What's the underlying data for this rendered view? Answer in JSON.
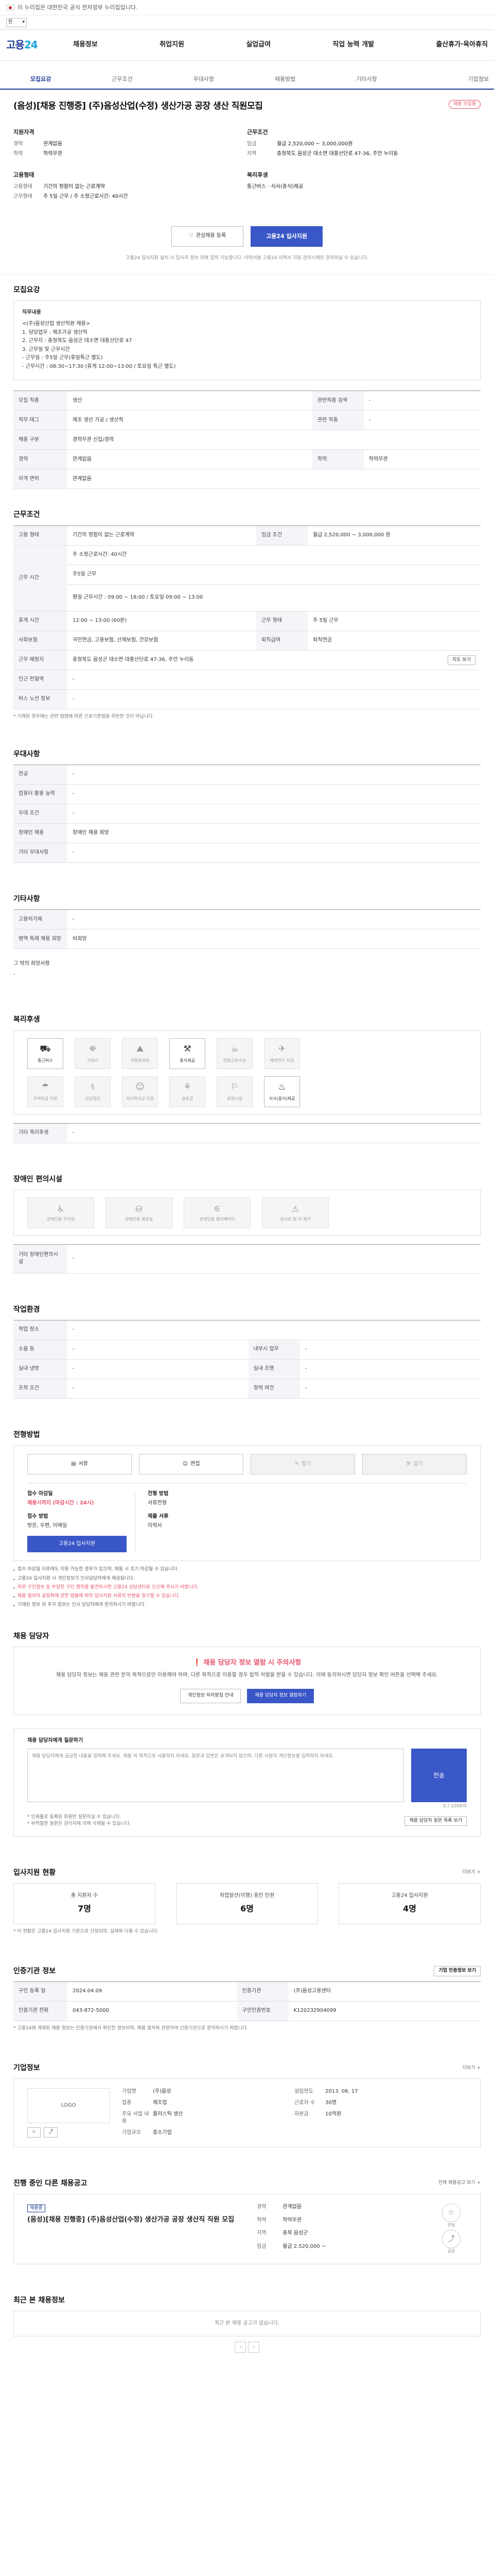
{
  "topbar": {
    "notice": "이 누리집은 대한민국 공식 전자정부 누리집입니다."
  },
  "lang": {
    "selected": "한"
  },
  "logo": {
    "a": "고용",
    "b": "24"
  },
  "gnb": [
    "채용정보",
    "취업지원",
    "실업급여",
    "직업 능력 개발",
    "출산휴가·육아휴직"
  ],
  "tabs": [
    "모집요강",
    "근무조건",
    "우대사항",
    "채용방법",
    "기타사항",
    "기업정보"
  ],
  "hero": {
    "title": "(음성)[채용 진행중] (주)음성산업(수정) 생산가공 공장 생산 직원모집",
    "badge": "채용 모집중",
    "col1_title": "지원자격",
    "col1": [
      {
        "k": "경력",
        "v": "관계없음"
      },
      {
        "k": "학력",
        "v": "학력무관"
      }
    ],
    "col2_title": "근무조건",
    "col2": [
      {
        "k": "임금",
        "v": "월급 2,520,000 ~ 3,000,000원"
      },
      {
        "k": "지역",
        "v": "충청북도 음성군 대소면 대풍산단로 47-36, 주안 누리동"
      }
    ],
    "col3_title": "고용형태",
    "col3": [
      {
        "k": "고용형태",
        "v": "기간의 정함이 없는 근로계약"
      },
      {
        "k": "근무형태",
        "v": "주 5일 근무 / 주 소정근로시간: 40시간"
      }
    ],
    "col4_title": "복리후생",
    "col4": [
      {
        "k": "",
        "v": "통근버스 · 식사(중식)제공"
      }
    ],
    "btn_save": "관심채용 등록",
    "btn_apply": "고용24 입사지원",
    "note": "고용24 입사지원 설치 시 입사지 정보 위해 입력 가능합니다. 이력서를 고용24 이력서 지원 관리시에만 관리하실 수 있습니다."
  },
  "recruit": {
    "title": "모집요강",
    "jobdesc": [
      "직무내용",
      "<(주)음성산업 생산직원 채용>",
      "1. 담당업무 : 제조가공 생산직",
      "2. 근무지 : 충청북도 음성군 대소면 대풍산단로 47",
      "3. 근무일 및 근무시간",
      "- 근무일 : 주5일 근무(휴일특근 별도)",
      "- 근무시간 : 08:30~17:30 (휴게 12:00~13:00 / 토요일 특근 별도)"
    ],
    "rows": [
      [
        {
          "k": "모집 직종",
          "v": "생산"
        },
        {
          "k": "관련직종 검색",
          "v": "-"
        }
      ],
      [
        {
          "k": "직무 태그",
          "v": "제조 생산 가공 / 생산직"
        },
        {
          "k": "관련 직종",
          "v": "-"
        }
      ],
      [
        {
          "k": "채용 구분",
          "v": "경력무관 신입/경력"
        },
        {
          "k": "",
          "v": ""
        }
      ],
      [
        {
          "k": "경력",
          "v": "관계없음"
        },
        {
          "k": "학력",
          "v": "학력무관"
        }
      ],
      [
        {
          "k": "자격 면허",
          "v": "관계없음"
        },
        {
          "k": "",
          "v": ""
        }
      ]
    ]
  },
  "work": {
    "title": "근무조건",
    "rows": [
      {
        "k": "고용 형태",
        "v": "기간의 정함이 없는 근로계약",
        "k2": "임금 조건",
        "v2": "월급 2,520,000 ~ 3,000,000 원"
      },
      {
        "k": "근무 시간",
        "v": "주 소정근로시간: 40시간",
        "k2": "",
        "v2": ""
      },
      {
        "k": "근무 형태",
        "v": "주5일 근무",
        "k2": "",
        "v2": ""
      },
      {
        "k": "",
        "v": "평일 근무시간 : 09:00 ~ 18:00 / 토요일 09:00 ~ 13:00",
        "k2": "",
        "v2": ""
      },
      {
        "k": "휴게 시간",
        "v": "12:00 ~ 13:00 (60분)",
        "k2": "근무 형태",
        "v2": "주 5일 근무"
      },
      {
        "k": "사회보험",
        "v": "국민연금, 고용보험, 산재보험, 건강보험",
        "k2": "퇴직급여",
        "v2": "퇴직연금"
      },
      {
        "k": "근무 예정지",
        "v": "충청북도 음성군 대소면 대풍산단로 47-36, 주안 누리동",
        "k2": "",
        "v2": ""
      },
      {
        "k": "인근 전철역",
        "v": "-",
        "k2": "",
        "v2": ""
      },
      {
        "k": "버스 노선 정보",
        "v": "-",
        "k2": "",
        "v2": ""
      }
    ],
    "map_btn": "지도 보기",
    "note": "* 기재된 경우에는 관련 법령에 따른 근로기준법을 위반한 것이 아닙니다."
  },
  "pref": {
    "title": "우대사항",
    "rows": [
      {
        "k": "전공",
        "v": "-"
      },
      {
        "k": "컴퓨터 활용 능력",
        "v": "-"
      },
      {
        "k": "우대 조건",
        "v": "-"
      },
      {
        "k": "장애인 채용",
        "v": "장애인 채용 희망"
      },
      {
        "k": "기타 우대사항",
        "v": "-"
      }
    ]
  },
  "etc": {
    "title": "기타사항",
    "rows": [
      {
        "k": "고용허가제",
        "v": "-"
      },
      {
        "k": "병역 특례 채용 희망",
        "v": "비희망"
      }
    ],
    "extra_k": "그 밖의 희망사항",
    "extra_v": "-"
  },
  "welfare": {
    "title": "복리후생",
    "items": [
      {
        "icon": "⛟",
        "label": "통근버스",
        "on": true
      },
      {
        "icon": "⛯",
        "label": "기숙사",
        "on": false
      },
      {
        "icon": "⛰",
        "label": "차량유지비",
        "on": false
      },
      {
        "icon": "⚒",
        "label": "중식제공",
        "on": true
      },
      {
        "icon": "☕",
        "label": "연장근로수당",
        "on": false
      },
      {
        "icon": "✈",
        "label": "해외연수 지원",
        "on": false
      },
      {
        "icon": "☂",
        "label": "주택자금 지원",
        "on": false
      },
      {
        "icon": "⚕",
        "label": "건강검진",
        "on": false
      },
      {
        "icon": "☺",
        "label": "자녀학자금 지원",
        "on": false
      },
      {
        "icon": "⚘",
        "label": "경조금",
        "on": false
      },
      {
        "icon": "⚐",
        "label": "휴양시설",
        "on": false
      },
      {
        "icon": "♨",
        "label": "식사(중식)제공",
        "on": true
      }
    ],
    "other_k": "기타 복리후생",
    "other_v": "-"
  },
  "disabled": {
    "title": "장애인 편의시설",
    "items": [
      {
        "icon": "♿",
        "label": "장애인용 주차장"
      },
      {
        "icon": "⛁",
        "label": "장애인용 화장실"
      },
      {
        "icon": "⚟",
        "label": "장애인용 엘리베이터"
      },
      {
        "icon": "⚠",
        "label": "경사로 및 턱 제거"
      }
    ],
    "other_k": "기타 장애인편의시설",
    "other_v": "-"
  },
  "workenv": {
    "title": "작업환경",
    "rows": [
      {
        "k": "작업 장소",
        "v": "-",
        "k2": "",
        "v2": ""
      },
      {
        "k": "소음 등",
        "v": "-",
        "k2": "내부시 업무",
        "v2": "-"
      },
      {
        "k": "실내 냉방",
        "v": "-",
        "k2": "실내 조명",
        "v2": "-"
      },
      {
        "k": "조작 조건",
        "v": "-",
        "k2": "청력 여건",
        "v2": "-"
      }
    ]
  },
  "apply": {
    "title": "전형방법",
    "seg": [
      "서류",
      "면접",
      "필기",
      "실기"
    ],
    "deadline_lbl": "접수 마감일",
    "deadline_val": "채용시까지 (마감시간 : 24시)",
    "method_lbl": "접수 방법",
    "method_val": "방문, 우편, 이메일",
    "btn": "고용24 입사지원",
    "screen_lbl": "전형 방법",
    "screen_val": "서류전형",
    "docs_lbl": "제출 서류",
    "docs_val": "이력서",
    "bullets": [
      {
        "t": "접수 마감일 이후에도 지원 가능한 경우가 있으며, 채용 시 조기 마감될 수 있습니다.",
        "red": false
      },
      {
        "t": "고용24 입사지원 시 개인정보가 인사담당자에게 제공됩니다.",
        "red": false
      },
      {
        "t": "허위 구인정보 등 부당한 구인 행위를 발견하시면 고용24 상담센터로 신고해 주시기 바랍니다.",
        "red": true
      },
      {
        "t": "채용 절차의 공정화에 관한 법률에 따라 입사지원 서류의 반환을 청구할 수 있습니다.",
        "red": true
      },
      {
        "t": "기재된 정보 외 추가 정보는 인사 담당자에게 문의하시기 바랍니다.",
        "red": false
      }
    ]
  },
  "manager": {
    "title": "채용 담당자",
    "t1": "❗ 채용 담당자 정보 열람 시 주의사항",
    "t2": "채용 담당자 정보는 채용 관련 문의 목적으로만 이용해야 하며, 다른 목적으로 이용할 경우 법적 처벌을 받을 수 있습니다. 이에 동의하시면 담당자 정보 확인 버튼을 선택해 주세요.",
    "btn1": "개인정보 처리방침 안내",
    "btn2": "채용 담당자 정보 열람하기"
  },
  "ask": {
    "title": "채용 담당자에게 질문하기",
    "placeholder": "채용 담당자에게 궁금한 내용을 입력해 주세요. 채용 외 목적으로 사용하지 마세요. 질문과 답변은 공개되지 않으며, 다른 사람의 개인정보를 입력하지 마세요.",
    "send": "전송",
    "count": "0 / 1000자",
    "note1": "* 인재풀로 등록된 회원만 질문하실 수 있습니다.",
    "note2": "* 부적절한 질문은 관리자에 의해 삭제될 수 있습니다.",
    "btn": "채용 담당자 질문 목록 보기"
  },
  "status": {
    "title": "입사지원 현황",
    "more": "더보기 +",
    "items": [
      {
        "label": "총 지원자 수",
        "val": "7명"
      },
      {
        "label": "취업알선(이행) 중인 인원",
        "val": "6명"
      },
      {
        "label": "고용24 입사지원",
        "val": "4명"
      }
    ],
    "note": "* 이 현황은 고용24 입사지원 기준으로 산정되며, 실제와 다를 수 있습니다."
  },
  "agency": {
    "title": "인증기관 정보",
    "btn": "기업 인증정보 보기",
    "rows": [
      {
        "k": "구인 등록 일",
        "v": "2024.04.09",
        "k2": "인증기관",
        "v2": "(주)음성고용센터"
      },
      {
        "k": "인증기관 전화",
        "v": "043-872-5000",
        "k2": "구인인증번호",
        "v2": "K120232904099"
      }
    ],
    "note": "* 고용24에 게재된 채용 정보는 인증기관에서 확인한 정보이며, 채용 절차와 관련하여 인증기관으로 문의하시기 바랍니다."
  },
  "company": {
    "title": "기업정보",
    "more": "더보기 +",
    "logo": "LOGO",
    "rows": [
      {
        "k": "기업명",
        "v": "(주)음성",
        "k2": "설립연도",
        "v2": "2013. 06. 17"
      },
      {
        "k": "업종",
        "v": "제조업",
        "k2": "근로자 수",
        "v2": "30명"
      },
      {
        "k": "주요 사업 내용",
        "v": "플라스틱 생산",
        "k2": "자본금",
        "v2": "10억원"
      },
      {
        "k": "기업규모",
        "v": "중소기업",
        "k2": "",
        "v2": ""
      }
    ]
  },
  "other": {
    "title": "진행 중인 다른 채용공고",
    "more": "전체 채용공고 보기 +",
    "label": "채용중",
    "job_title": "(음성)[채용 진행중] (주)음성산업(수정) 생산가공 공장 생산직 직원 모집",
    "rows": [
      {
        "k": "경력",
        "v": "관계없음"
      },
      {
        "k": "학력",
        "v": "학력무관"
      },
      {
        "k": "지역",
        "v": "충북 음성군"
      },
      {
        "k": "임금",
        "v": "월급 2,520,000 ~"
      }
    ],
    "icons": [
      "관심",
      "공유"
    ]
  },
  "viewed": {
    "title": "최근 본 채용정보",
    "empty": "최근 본 채용 공고가 없습니다."
  }
}
